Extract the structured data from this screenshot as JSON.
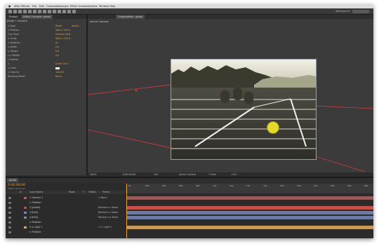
{
  "menubar": {
    "items": [
      "After Effects",
      "File",
      "Edit",
      "Composition",
      "Layer",
      "Effect",
      "Animation",
      "View",
      "Window",
      "Help"
    ],
    "workspace": "Workspace:",
    "workspace_value": "Standard"
  },
  "left_panel": {
    "tab_project": "Project",
    "tab_effect": "Effect Controls: photo",
    "title": "photo • Camera",
    "rows": [
      {
        "label": "▾ Light",
        "v1": "Reset",
        "v2": "About..."
      },
      {
        "label": "  ⊙ Position",
        "v1": "360.0, 243.0",
        "v2": ""
      },
      {
        "label": "  Tiny Point",
        "v1": "Position Shift",
        "v2": ""
      },
      {
        "label": "  ⊙ Scale",
        "v1": "360.0, 243.0",
        "v2": ""
      },
      {
        "label": "  ⊙ Rotation",
        "v1": "0x",
        "v2": ""
      },
      {
        "label": "  ⊙ Width",
        "v1": "0.0",
        "v2": ""
      },
      {
        "label": "  ⊙ Height",
        "v1": "0.0",
        "v2": ""
      },
      {
        "label": "▸ ⊙ Border",
        "v1": "0.0",
        "v2": ""
      },
      {
        "label": "▸ Feather",
        "v1": "",
        "v2": ""
      },
      {
        "label": "  ⊙ ",
        "v1": "Invert Grid",
        "v2": ""
      },
      {
        "label": "  ⊙ Color",
        "v1": "",
        "v2": ""
      },
      {
        "label": "  ⊙ Opacity",
        "v1": "100.0%",
        "v2": ""
      },
      {
        "label": "  Blending Mode",
        "v1": "None",
        "v2": ""
      }
    ]
  },
  "comp_panel": {
    "tab": "Composition: photo",
    "tab_sub": "photo",
    "camera_label": "Active Camera",
    "bottom": [
      "100%",
      "0:00:00:00",
      "Full",
      "Active Camera",
      "1 View",
      "+0.0"
    ]
  },
  "timeline": {
    "tab": "photo",
    "timecode": "0:00:00:00",
    "fps": "00000 (30.00 fps)",
    "header": [
      "#",
      "Layer Name",
      "Mode",
      "T",
      "TrkMat",
      "Parent"
    ],
    "ruler": [
      "0s",
      "02s",
      "04s",
      "06s",
      "08s",
      "10s",
      "12s",
      "14s",
      "16s",
      "18s",
      "20s",
      "22s",
      "24s",
      "26s",
      "28s"
    ],
    "layers": [
      {
        "name": "1  Camera 1",
        "value": "",
        "mode": "⊙  None",
        "color": "#c95a4a",
        "bar": "#9a5a56"
      },
      {
        "name": "   ⊙ Position",
        "value": "",
        "mode": "",
        "color": "",
        "bar": ""
      },
      {
        "name": "2  [photo]",
        "value": "",
        "mode": "Normal  ▾  ⊙ None",
        "color": "#d0463a",
        "bar": "#c8504a"
      },
      {
        "name": "3  [Null]",
        "value": "",
        "mode": "Normal  ▾  ⊙ None",
        "color": "#7a86b5",
        "bar": "#6c7aa6"
      },
      {
        "name": "4  [Null]",
        "value": "",
        "mode": "Normal  ▾  ⊙ None",
        "color": "#7a86b5",
        "bar": "#6c7aa6"
      },
      {
        "name": "   ⊙ Position",
        "value": "",
        "mode": "",
        "color": "",
        "bar": ""
      },
      {
        "name": "5  ⊙ Light 1",
        "value": "",
        "mode": "⊙  5. Light 1",
        "color": "#d9a85b",
        "bar": "#c69a5a"
      },
      {
        "name": "   ⊙ Position",
        "value": "",
        "mode": "",
        "color": "",
        "bar": ""
      }
    ]
  }
}
